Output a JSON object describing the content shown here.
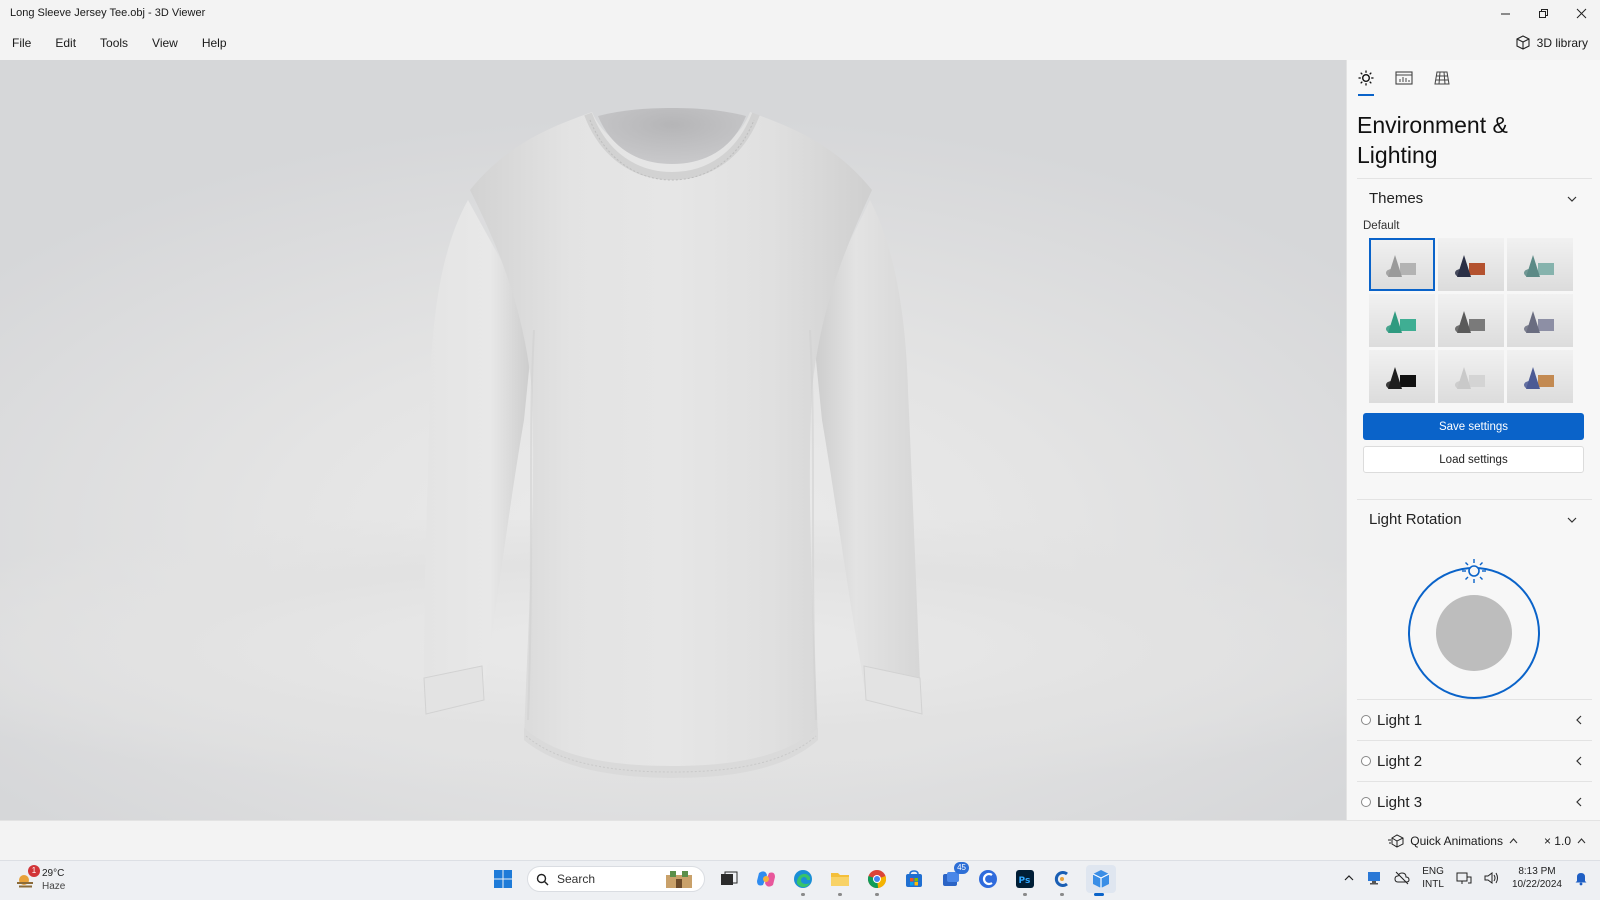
{
  "window": {
    "title": "Long Sleeve Jersey Tee.obj - 3D Viewer",
    "minimize_icon": "minimize-icon",
    "restore_icon": "restore-icon",
    "close_icon": "close-icon"
  },
  "menu": {
    "items": [
      "File",
      "Edit",
      "Tools",
      "View",
      "Help"
    ],
    "library_label": "3D library"
  },
  "panel": {
    "tabs": [
      "sun-icon",
      "stats-icon",
      "grid-icon"
    ],
    "heading_line1": "Environment &",
    "heading_line2": "Lighting",
    "themes": {
      "label": "Themes",
      "subtitle": "Default",
      "selected_index": 0,
      "tiles": [
        {
          "cone": "#9a9a9a",
          "box": "#b3b3b3"
        },
        {
          "cone": "#2a2f45",
          "box": "#b4522f"
        },
        {
          "cone": "#5c8a86",
          "box": "#86b3ad"
        },
        {
          "cone": "#2f9a80",
          "box": "#3fae93"
        },
        {
          "cone": "#5a5a5a",
          "box": "#7a7a7a"
        },
        {
          "cone": "#6a6d80",
          "box": "#8d8fa5"
        },
        {
          "cone": "#1e1e1e",
          "box": "#111111"
        },
        {
          "cone": "#c9c9c9",
          "box": "#d4d4d4"
        },
        {
          "cone": "#4c5a94",
          "box": "#c38a52"
        }
      ]
    },
    "save_label": "Save settings",
    "load_label": "Load settings",
    "light_rotation": {
      "label": "Light Rotation"
    },
    "lights": [
      "Light 1",
      "Light 2",
      "Light 3"
    ]
  },
  "status": {
    "quick_animations": "Quick Animations",
    "speed": "× 1.0"
  },
  "taskbar": {
    "weather": {
      "temp": "29°C",
      "condition": "Haze",
      "alert": "1"
    },
    "search_placeholder": "Search",
    "mail_badge": "45",
    "lang_line1": "ENG",
    "lang_line2": "INTL",
    "time": "8:13 PM",
    "date": "10/22/2024"
  },
  "colors": {
    "accent": "#0a63c9"
  }
}
